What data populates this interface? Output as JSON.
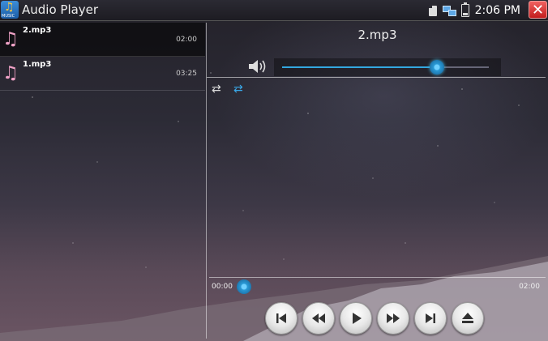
{
  "app": {
    "title": "Audio Player",
    "icon_text": "MUSIC"
  },
  "status": {
    "time": "2:06 PM",
    "close_label": "✕"
  },
  "playlist": [
    {
      "name": "2.mp3",
      "duration": "02:00",
      "active": true
    },
    {
      "name": "1.mp3",
      "duration": "03:25",
      "active": false
    }
  ],
  "now_playing": {
    "title": "2.mp3"
  },
  "volume": {
    "level": 0.75
  },
  "progress": {
    "elapsed": "00:00",
    "total": "02:00",
    "fraction": 0.02
  },
  "controls": [
    "previous",
    "rewind",
    "play",
    "fast-forward",
    "next",
    "eject"
  ],
  "colors": {
    "accent": "#33a8e0",
    "close": "#d32f2f",
    "note": "#f1a3c8"
  }
}
